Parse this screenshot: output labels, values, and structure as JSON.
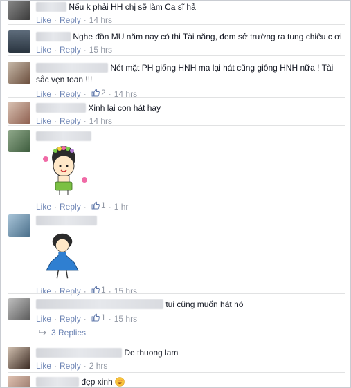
{
  "actions": {
    "like": "Like",
    "reply": "Reply",
    "dot": "·"
  },
  "comments": [
    {
      "text": "Nếu k phải HH chị sẽ làm Ca sĩ hả",
      "likes": "",
      "time": "14 hrs"
    },
    {
      "text": "Nghe đồn MU năm nay có thi Tài năng, đem sở trường ra tung chiêu c ơi",
      "likes": "",
      "time": "15 hrs"
    },
    {
      "text": "Nét mặt PH giống HNH ma lại hát cũng giông HNH nữa ! Tài sắc vẹn toan !!!",
      "likes": "2",
      "time": "14 hrs"
    },
    {
      "text": "Xinh lại con hát hay",
      "likes": "",
      "time": "14 hrs"
    },
    {
      "text": "",
      "likes": "1",
      "time": "1 hr"
    },
    {
      "text": "",
      "likes": "1",
      "time": "15 hrs"
    },
    {
      "text": "tui cũng muốn hát nó",
      "likes": "1",
      "time": "15 hrs"
    },
    {
      "text": "De thuong lam",
      "likes": "",
      "time": "2 hrs"
    },
    {
      "text": "đẹp xinh",
      "likes": "",
      "time": ""
    }
  ],
  "replies_label": "3 Replies",
  "colors": {
    "link": "#6d84b4",
    "meta": "#9197a3",
    "text": "#141823"
  }
}
